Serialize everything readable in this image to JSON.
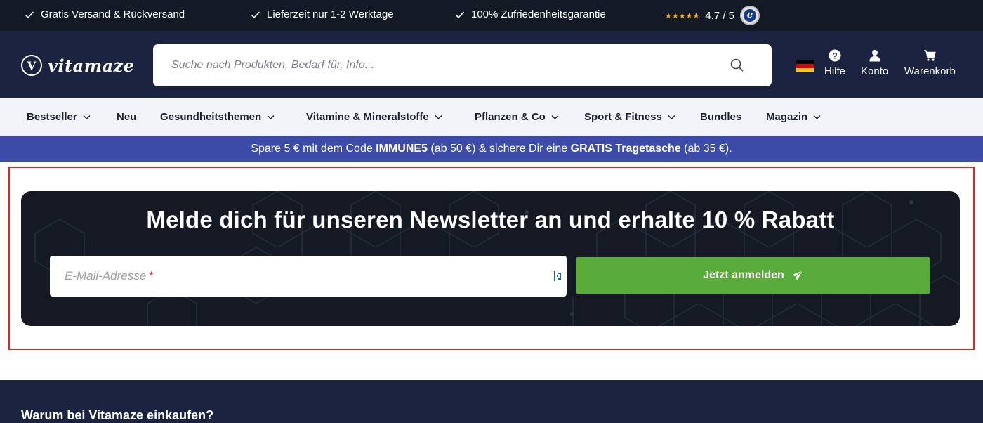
{
  "topbar": {
    "usps": [
      {
        "label": "Gratis Versand & Rückversand"
      },
      {
        "label": "Lieferzeit nur 1-2 Werktage"
      },
      {
        "label": "100% Zufriedenheitsgarantie"
      }
    ],
    "rating": {
      "stars": "★★★★★",
      "score": "4.7 / 5",
      "stars_value": 5,
      "badge_letter": "e"
    }
  },
  "header": {
    "logo_mark": "V",
    "logo_text": "vitamaze",
    "search": {
      "placeholder": "Suche nach Produkten, Bedarf für, Info..."
    },
    "actions": [
      {
        "label": "Hilfe",
        "icon": "help-icon"
      },
      {
        "label": "Konto",
        "icon": "user-icon"
      },
      {
        "label": "Warenkorb",
        "icon": "cart-icon"
      }
    ],
    "flag_colors": [
      "#000000",
      "#dd0000",
      "#ffcc00"
    ]
  },
  "nav": {
    "items": [
      {
        "label": "Bestseller",
        "dropdown": true
      },
      {
        "label": "Neu",
        "dropdown": false
      },
      {
        "label": "Gesundheitsthemen",
        "dropdown": true
      },
      {
        "label": "Vitamine & Mineralstoffe",
        "dropdown": true
      },
      {
        "label": "Pflanzen & Co",
        "dropdown": true
      },
      {
        "label": "Sport & Fitness",
        "dropdown": true
      },
      {
        "label": "Bundles",
        "dropdown": false
      },
      {
        "label": "Magazin",
        "dropdown": true
      }
    ]
  },
  "promo": {
    "part1": "Spare 5 € mit dem Code ",
    "code": "IMMUNE5",
    "part2": " (ab 50 €) & sichere Dir eine ",
    "gift": "GRATIS Tragetasche",
    "part3": " (ab 35 €)."
  },
  "newsletter": {
    "title": "Melde dich für unseren Newsletter an und erhalte 10 % Rabatt",
    "email_placeholder": "E-Mail-Adresse",
    "required_marker": "*",
    "submit_label": "Jetzt anmelden"
  },
  "why": {
    "title": "Warum bei Vitamaze einkaufen?"
  },
  "colors": {
    "topbar_bg": "#141a25",
    "header_bg": "#1c2340",
    "nav_bg": "#f3f4f7",
    "promo_bg": "#3c4ba8",
    "newsletter_bg": "#141923",
    "submit_green": "#5aac3a",
    "star_color": "#f7b500",
    "highlight_red": "#e0242b"
  }
}
